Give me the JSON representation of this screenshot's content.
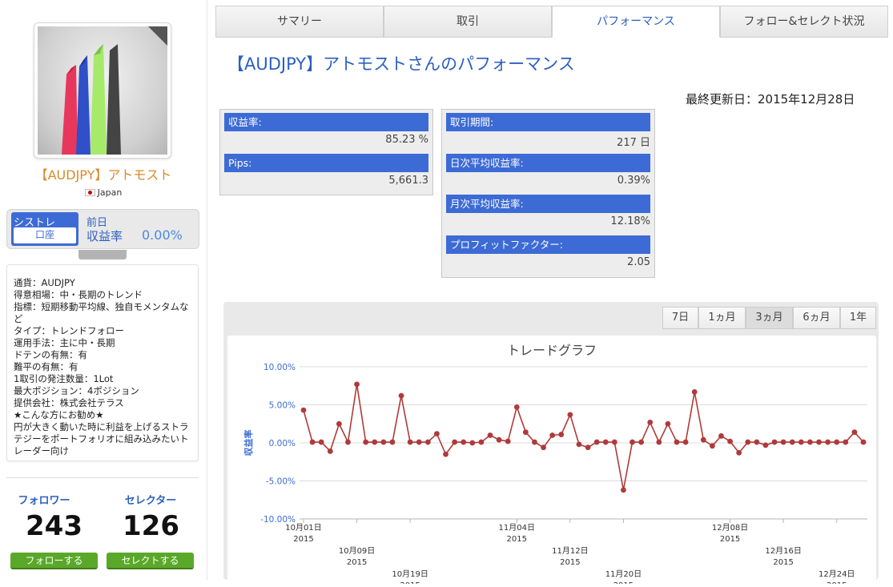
{
  "profile": {
    "name": "【AUDJPY】アトモスト",
    "country": "Japan",
    "sys_top": "シストレ",
    "sys_bottom": "口座",
    "prev_day": "前日",
    "yield_label": "収益率",
    "yield_value": "0.00%"
  },
  "description": [
    "通貨：AUDJPY",
    "得意相場：中・長期のトレンド",
    "指標：短期移動平均線、独自モメンタムなど",
    "タイプ：トレンドフォロー",
    "運用手法：主に中・長期",
    "ドテンの有無：有",
    "難平の有無：有",
    "1取引の発注数量：1Lot",
    "最大ポジション：4ポジション",
    "提供会社：株式会社テラス",
    "★こんな方にお勧め★",
    "円が大きく動いた時に利益を上げるストラテジーをポートフォリオに組み込みたいトレーダー向け"
  ],
  "counts": {
    "followers_label": "フォロワー",
    "followers": "243",
    "selectors_label": "セレクター",
    "selectors": "126",
    "follow_button": "フォローする",
    "select_button": "セレクトする"
  },
  "tabs": [
    "サマリー",
    "取引",
    "パフォーマンス",
    "フォロー&セレクト状況"
  ],
  "page_title": "【AUDJPY】アトモストさんのパフォーマンス",
  "last_updated": "最終更新日：2015年12月28日",
  "metrics_left": [
    {
      "label": "収益率:",
      "value": "85.23 %"
    },
    {
      "label": "Pips:",
      "value": "5,661.3"
    }
  ],
  "metrics_right": [
    {
      "label": "取引期間:",
      "value": "217 日"
    },
    {
      "label": "日次平均収益率:",
      "value": "0.39%"
    },
    {
      "label": "月次平均収益率:",
      "value": "12.18%"
    },
    {
      "label": "プロフィットファクター:",
      "value": "2.05"
    }
  ],
  "range_buttons": [
    "7日",
    "1ヵ月",
    "3ヵ月",
    "6ヵ月",
    "1年"
  ],
  "range_selected": "3ヵ月",
  "colors": {
    "accent": "#3d6bd5",
    "line": "#b03a3a",
    "button_green": "#5aa829",
    "name": "#d98a2a"
  },
  "chart_data": {
    "type": "line",
    "title": "トレードグラフ",
    "ylabel": "収益率",
    "ylim": [
      -10,
      10
    ],
    "yticks": [
      "10.00%",
      "5.00%",
      "0.00%",
      "-5.00%",
      "-10.00%"
    ],
    "xtick_labels": [
      {
        "date": "10月01日",
        "year": "2015"
      },
      {
        "date": "10月09日",
        "year": "2015"
      },
      {
        "date": "10月19日",
        "year": "2015"
      },
      {
        "date": "11月04日",
        "year": "2015"
      },
      {
        "date": "11月12日",
        "year": "2015"
      },
      {
        "date": "11月20日",
        "year": "2015"
      },
      {
        "date": "12月08日",
        "year": "2015"
      },
      {
        "date": "12月16日",
        "year": "2015"
      },
      {
        "date": "12月24日",
        "year": "2015"
      }
    ],
    "series": [
      {
        "values": [
          4.3,
          0.1,
          0.1,
          -1.1,
          2.5,
          0.1,
          7.7,
          0.1,
          0.1,
          0.1,
          0.1,
          6.2,
          0.1,
          0.1,
          0.1,
          1.2,
          -1.5,
          0.1,
          0.1,
          0.0,
          0.1,
          1.0,
          0.4,
          0.2,
          4.7,
          1.4,
          0.1,
          -0.6,
          1.0,
          1.1,
          3.7,
          -0.2,
          -0.6,
          0.1,
          0.1,
          0.1,
          -6.2,
          0.1,
          0.1,
          2.7,
          0.1,
          2.5,
          0.1,
          0.1,
          6.7,
          0.4,
          -0.4,
          0.9,
          0.2,
          -1.3,
          0.1,
          0.1,
          -0.3,
          0.1,
          0.1,
          0.1,
          0.1,
          0.1,
          0.1,
          0.1,
          0.1,
          0.1,
          1.4,
          0.1
        ]
      }
    ]
  }
}
